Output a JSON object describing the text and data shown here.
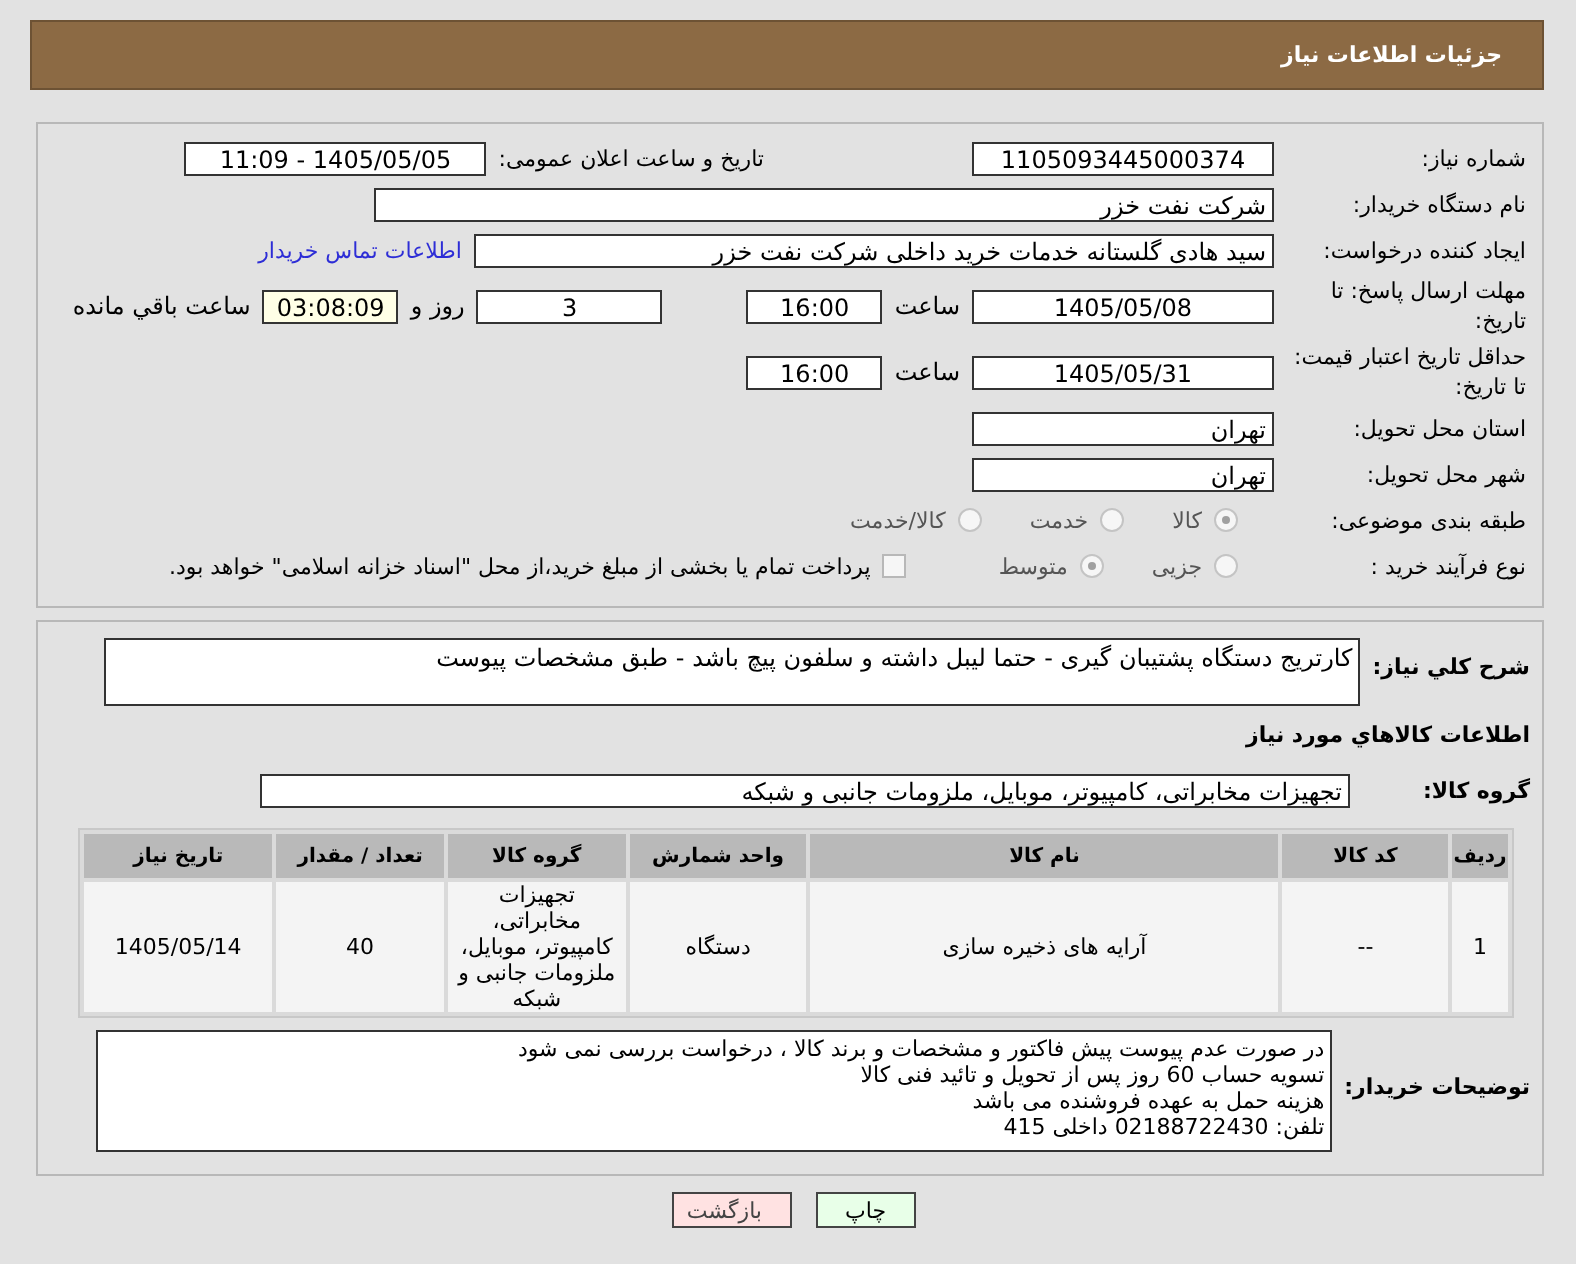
{
  "header": {
    "title": "جزئیات اطلاعات نیاز"
  },
  "need_number": {
    "label": "شماره نیاز:",
    "value": "1105093445000374"
  },
  "announce": {
    "label": "تاریخ و ساعت اعلان عمومی:",
    "value": "1405/05/05 - 11:09"
  },
  "buyer_org": {
    "label": "نام دستگاه خریدار:",
    "value": "شرکت نفت خزر"
  },
  "requester": {
    "label": "ایجاد کننده درخواست:",
    "value": "سید هادی گلستانه خدمات خرید داخلی شرکت نفت خزر",
    "link": "اطلاعات تماس خریدار"
  },
  "response_deadline": {
    "label": "مهلت ارسال پاسخ: تا تاریخ:",
    "date": "1405/05/08",
    "time_label": "ساعت",
    "time": "16:00",
    "days": "3",
    "days_label": "روز و",
    "remaining": "03:08:09",
    "remaining_label": "ساعت باقي مانده"
  },
  "price_validity": {
    "label": "حداقل تاریخ اعتبار قیمت: تا تاریخ:",
    "date": "1405/05/31",
    "time_label": "ساعت",
    "time": "16:00"
  },
  "province": {
    "label": "استان محل تحویل:",
    "value": "تهران"
  },
  "city": {
    "label": "شهر محل تحویل:",
    "value": "تهران"
  },
  "category": {
    "label": "طبقه بندی موضوعی:",
    "options": [
      {
        "label": "کالا",
        "selected": true
      },
      {
        "label": "خدمت",
        "selected": false
      },
      {
        "label": "کالا/خدمت",
        "selected": false
      }
    ]
  },
  "process": {
    "label": "نوع فرآیند خرید :",
    "options": [
      {
        "label": "جزیی",
        "selected": false
      },
      {
        "label": "متوسط",
        "selected": true
      }
    ],
    "payment": {
      "label": "پرداخت تمام یا بخشی از مبلغ خرید،از محل \"اسناد خزانه اسلامی\" خواهد بود.",
      "checked": false
    }
  },
  "description": {
    "label": "شرح کلي نیاز:",
    "value": "کارتریج دستگاه پشتیبان گیری - حتما لیبل داشته و سلفون پیچ باشد - طبق مشخصات پیوست"
  },
  "goods_title": "اطلاعات کالاهاي مورد نیاز",
  "goods_group": {
    "label": "گروه کالا:",
    "value": "تجهیزات مخابراتی، کامپیوتر، موبایل، ملزومات جانبی و شبکه"
  },
  "table": {
    "columns": [
      "ردیف",
      "کد کالا",
      "نام کالا",
      "واحد شمارش",
      "گروه کالا",
      "تعداد / مقدار",
      "تاریخ نیاز"
    ],
    "rows": [
      [
        "1",
        "--",
        "آرایه های ذخیره سازی",
        "دستگاه",
        "تجهیزات مخابراتی، کامپیوتر، موبایل، ملزومات جانبی و شبکه",
        "40",
        "1405/05/14"
      ]
    ]
  },
  "buyer_notes": {
    "label": "توضیحات خریدار:",
    "lines": [
      "در صورت عدم پیوست پیش فاکتور و مشخصات و برند کالا ، درخواست بررسی نمی شود",
      "تسویه حساب 60 روز پس از تحویل و تائید فنی کالا",
      "هزینه حمل به عهده فروشنده می باشد",
      "تلفن: 02188722430 داخلی 415"
    ]
  },
  "buttons": [
    {
      "label": "چاپ",
      "kind": "print"
    },
    {
      "label": "بازگشت",
      "kind": "back"
    }
  ]
}
